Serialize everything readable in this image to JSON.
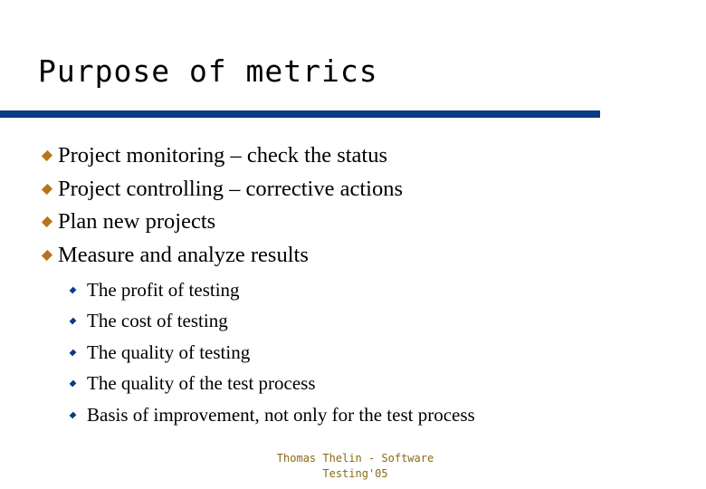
{
  "slide": {
    "title": "Purpose of metrics",
    "colors": {
      "rule": "#0b3a86",
      "main_bullet": "#b8741a",
      "sub_bullet": "#0b3a86",
      "footer_text": "#8a6a10"
    },
    "bullets": [
      {
        "icon": "diamond-bullet",
        "text": "Project monitoring – check the status"
      },
      {
        "icon": "diamond-bullet",
        "text": "Project controlling – corrective actions"
      },
      {
        "icon": "diamond-bullet",
        "text": "Plan new projects"
      },
      {
        "icon": "diamond-bullet",
        "text": "Measure and analyze results"
      }
    ],
    "sub_bullets": [
      {
        "icon": "diamond-bullet",
        "text": "The profit of testing"
      },
      {
        "icon": "diamond-bullet",
        "text": "The cost of testing"
      },
      {
        "icon": "diamond-bullet",
        "text": "The quality of testing"
      },
      {
        "icon": "diamond-bullet",
        "text": "The quality of the test process"
      },
      {
        "icon": "diamond-bullet",
        "text": "Basis of improvement, not only for the test process"
      }
    ],
    "footer": {
      "line1": "Thomas Thelin - Software",
      "line2": "Testing'05"
    }
  }
}
